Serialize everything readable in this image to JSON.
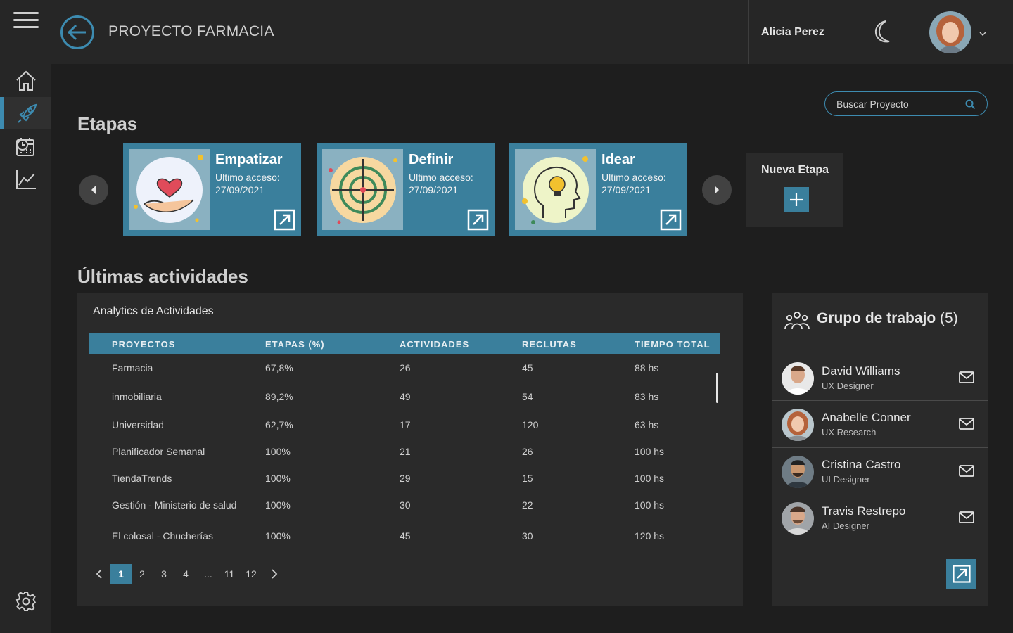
{
  "header": {
    "title": "PROYECTO FARMACIA",
    "user_name": "Alicia Perez"
  },
  "search": {
    "placeholder": "Buscar Proyecto"
  },
  "stages_section": {
    "title": "Etapas",
    "cards": [
      {
        "name": "Empatizar",
        "access_label": "Ultimo acceso:",
        "access_date": "27/09/2021"
      },
      {
        "name": "Definir",
        "access_label": "Ultimo acceso:",
        "access_date": "27/09/2021"
      },
      {
        "name": "Idear",
        "access_label": "Ultimo acceso:",
        "access_date": "27/09/2021"
      }
    ],
    "new_stage_label": "Nueva Etapa"
  },
  "activities_section": {
    "title": "Últimas actividades",
    "panel_title": "Analytics de Actividades",
    "columns": [
      "PROYECTOS",
      "ETAPAS (%)",
      "ACTIVIDADES",
      "RECLUTAS",
      "TIEMPO TOTAL"
    ],
    "rows": [
      [
        "Farmacia",
        "67,8%",
        "26",
        "45",
        "88 hs"
      ],
      [
        "inmobiliaria",
        "89,2%",
        "49",
        "54",
        "83 hs"
      ],
      [
        "Universidad",
        "62,7%",
        "17",
        "120",
        "63 hs"
      ],
      [
        "Planificador Semanal",
        "100%",
        "21",
        "26",
        "100 hs"
      ],
      [
        "TiendaTrends",
        "100%",
        "29",
        "15",
        "100 hs"
      ],
      [
        "Gestión - Ministerio de salud",
        "100%",
        "30",
        "22",
        "100 hs"
      ],
      [
        "El colosal - Chucherías",
        "100%",
        "45",
        "30",
        "120 hs"
      ]
    ],
    "pagination": [
      "1",
      "2",
      "3",
      "4",
      "...",
      "11",
      "12"
    ],
    "current_page": "1"
  },
  "team": {
    "title": "Grupo de trabajo",
    "count": "(5)",
    "members": [
      {
        "name": "David Williams",
        "role": "UX Designer"
      },
      {
        "name": "Anabelle Conner",
        "role": "UX Research"
      },
      {
        "name": "Cristina Castro",
        "role": "UI Designer"
      },
      {
        "name": "Travis Restrepo",
        "role": "AI Designer"
      }
    ]
  },
  "colors": {
    "accent": "#3a7f9c",
    "background": "#1e1e1e",
    "panel": "#2a2a2a",
    "sidebar": "#262626"
  },
  "icons": {
    "sidebar": [
      "menu-icon",
      "home-icon",
      "rocket-icon",
      "calendar-icon",
      "chart-icon",
      "settings-icon"
    ],
    "header": [
      "back-arrow-icon",
      "moon-icon",
      "chevron-down-icon"
    ],
    "misc": [
      "search-icon",
      "external-link-icon",
      "plus-icon",
      "team-icon",
      "mail-icon"
    ]
  }
}
